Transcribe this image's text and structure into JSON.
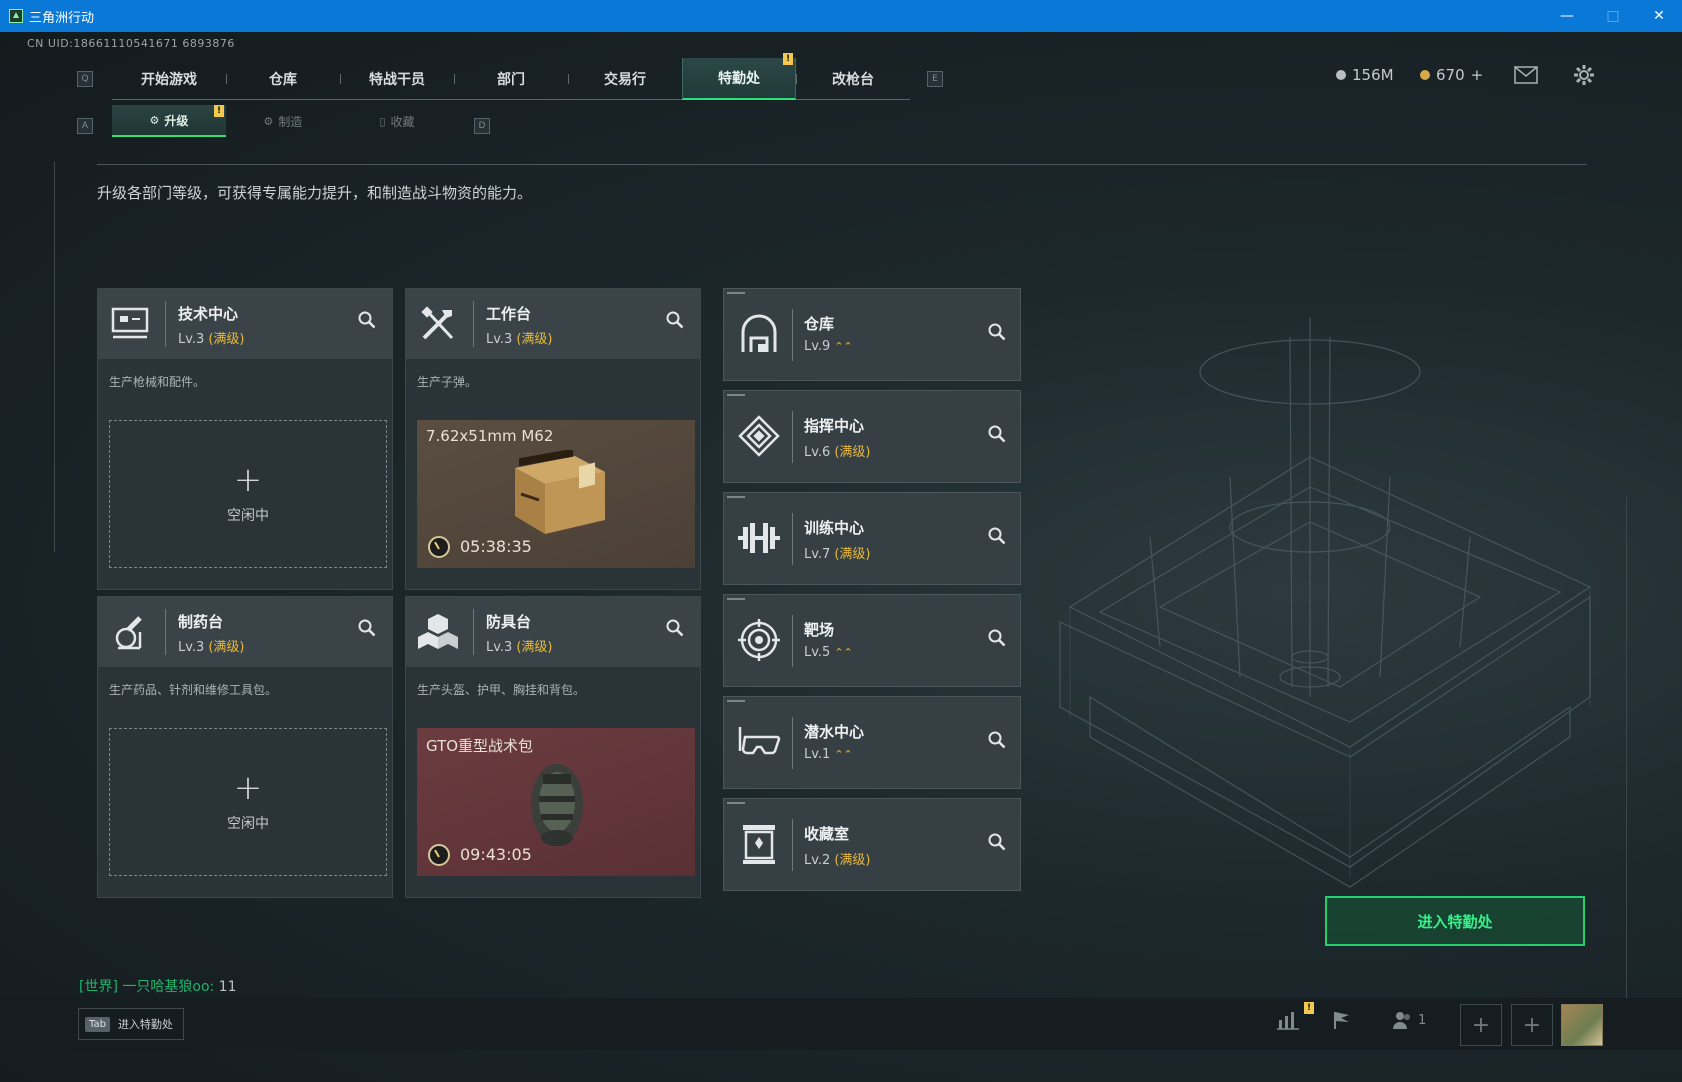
{
  "window": {
    "title": "三角洲行动"
  },
  "uid": "CN UID:18661110541671 6893876",
  "nav": {
    "key_left": "Q",
    "key_right": "E",
    "tabs": [
      {
        "label": "开始游戏"
      },
      {
        "label": "仓库"
      },
      {
        "label": "特战干员"
      },
      {
        "label": "部门"
      },
      {
        "label": "交易行"
      },
      {
        "label": "特勤处",
        "active": true
      },
      {
        "label": "改枪台"
      }
    ],
    "new_badge": "!"
  },
  "currency": {
    "silver": "156M",
    "gold": "670",
    "gold_add": "+"
  },
  "subnav": {
    "key_left": "A",
    "key_right": "D",
    "tabs": [
      {
        "label": "升级",
        "active": true
      },
      {
        "label": "制造"
      },
      {
        "label": "收藏"
      }
    ],
    "new_badge": "!"
  },
  "description": "升级各部门等级，可获得专属能力提升，和制造战斗物资的能力。",
  "stations": [
    {
      "name": "技术中心",
      "level": "Lv.3",
      "max": "(满级)",
      "desc": "生产枪械和配件。",
      "state": "idle",
      "idle_text": "空闲中",
      "plus": "+"
    },
    {
      "name": "工作台",
      "level": "Lv.3",
      "max": "(满级)",
      "desc": "生产子弹。",
      "state": "producing",
      "item": "7.62x51mm M62",
      "timer": "05:38:35"
    },
    {
      "name": "制药台",
      "level": "Lv.3",
      "max": "(满级)",
      "desc": "生产药品、针剂和维修工具包。",
      "state": "idle",
      "idle_text": "空闲中",
      "plus": "+"
    },
    {
      "name": "防具台",
      "level": "Lv.3",
      "max": "(满级)",
      "desc": "生产头盔、护甲、胸挂和背包。",
      "state": "producing",
      "item": "GTO重型战术包",
      "timer": "09:43:05"
    }
  ],
  "departments": [
    {
      "name": "仓库",
      "level": "Lv.9",
      "upgrade": "⌃⌃"
    },
    {
      "name": "指挥中心",
      "level": "Lv.6",
      "max": "(满级)"
    },
    {
      "name": "训练中心",
      "level": "Lv.7",
      "max": "(满级)"
    },
    {
      "name": "靶场",
      "level": "Lv.5",
      "upgrade": "⌃⌃"
    },
    {
      "name": "潜水中心",
      "level": "Lv.1",
      "upgrade": "⌃⌃"
    },
    {
      "name": "收藏室",
      "level": "Lv.2",
      "max": "(满级)"
    }
  ],
  "enter_button": "进入特勤处",
  "chat": {
    "channel": "[世界] 一只哈基狼oo:",
    "message": " 11"
  },
  "tab_hint": {
    "key": "Tab",
    "label": "进入特勤处"
  },
  "bottom": {
    "friends_count": "1"
  },
  "colors": {
    "accent": "#2fe07e",
    "max_level": "#e8b93a",
    "titlebar": "#0a78d7"
  },
  "icons": [
    "tech-center-icon",
    "workbench-icon",
    "pharmacy-icon",
    "armor-bench-icon",
    "warehouse-icon",
    "command-center-icon",
    "training-center-icon",
    "shooting-range-icon",
    "diving-center-icon",
    "collection-room-icon",
    "search-icon",
    "mail-icon",
    "gear-icon"
  ]
}
